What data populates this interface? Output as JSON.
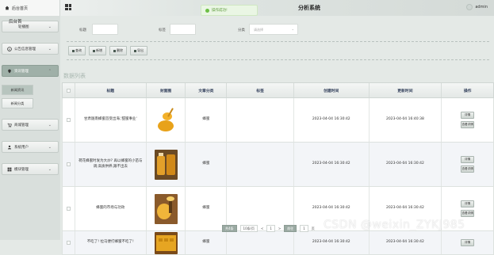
{
  "brand": {
    "label": "后台首页"
  },
  "header": {
    "title": "分析系统",
    "user": "admin"
  },
  "toast": {
    "text": "操作成功!"
  },
  "sidebar": {
    "items": [
      {
        "label": "轮播图",
        "icon": "image-icon"
      },
      {
        "label": "公告信息管理",
        "icon": "info-icon"
      },
      {
        "label": "资讯管理",
        "icon": "pin-icon",
        "active": true
      },
      {
        "label": "商城管理",
        "icon": "cart-icon"
      },
      {
        "label": "系统用户",
        "icon": "user-icon"
      },
      {
        "label": "模块管理",
        "icon": "grid-icon"
      }
    ],
    "floating_label": "后台首",
    "subitems": [
      {
        "label": "新闻资讯",
        "active": true
      },
      {
        "label": "新闻分类"
      }
    ]
  },
  "search": {
    "field1_label": "标题",
    "field2_label": "标签",
    "field3_label": "分类",
    "select_placeholder": "请选择"
  },
  "actions": {
    "search": "查询",
    "add": "新增",
    "delete": "删除",
    "export": "导出"
  },
  "list": {
    "title": "数据列表"
  },
  "table": {
    "columns": [
      "标题",
      "封面图",
      "文章分类",
      "标签",
      "创建时间",
      "更新时间",
      "操作"
    ],
    "rows": [
      {
        "title": "甘肃陇南蜂蜜首受出海,'甜蜜事业'",
        "category": "蜂蜜",
        "tag": "",
        "created": "2023-04-04 16:30:42",
        "updated": "2023-04-04 16:40:38",
        "thumb": "honey-dipper"
      },
      {
        "title": "荷花蜂蜜时发为大炒? 再以蜂蜜的小苗与调;高质供养,跟不出去",
        "category": "蜂蜜",
        "tag": "",
        "created": "2023-04-04 16:30:42",
        "updated": "2023-04-04 16:30:42",
        "thumb": "honey-jars"
      },
      {
        "title": "蜂蜜的市场与功效",
        "category": "蜂蜜",
        "tag": "",
        "created": "2023-04-04 16:30:42",
        "updated": "2023-04-04 16:30:42",
        "thumb": "honey-spoon"
      },
      {
        "title": "不吃了! 拉马便打蜂蜜不吃了!",
        "category": "蜂蜜",
        "tag": "",
        "created": "2023-04-04 16:30:42",
        "updated": "2023-04-04 16:30:42",
        "thumb": "honey-comb"
      }
    ],
    "op_edit": "详情",
    "op_detail": "查看详情"
  },
  "pager": {
    "total": "共4条",
    "size": "10条/页",
    "prev": "<",
    "page": "1",
    "next": ">",
    "goto_label": "前往",
    "goto_value": "1",
    "suffix": "页"
  },
  "watermark": "CSDN @weixin_ZYKJ985",
  "colors": {
    "accent": "#9fb0a8",
    "header_text": "#34415c",
    "toast": "#6cbf44"
  }
}
